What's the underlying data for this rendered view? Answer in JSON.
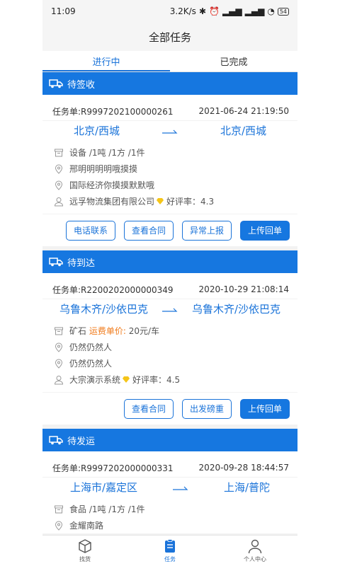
{
  "status_bar": {
    "time": "11:09",
    "speed": "3.2K/s",
    "battery": "54"
  },
  "header": {
    "title": "全部任务"
  },
  "tabs": [
    {
      "label": "进行中"
    },
    {
      "label": "已完成"
    }
  ],
  "cards": [
    {
      "status": "待签收",
      "task_no": "任务单:R9997202100000261",
      "datetime": "2021-06-24 21:19:50",
      "from": "北京/西城",
      "to": "北京/西城",
      "goods": "设备 /1吨 /1方 /1件",
      "addr1": "邢明明明明哦摸摸",
      "addr2": "国际经济你摸摸默默哦",
      "company": "远孚物流集团有限公司",
      "rating": "好评率：4.3",
      "buttons": [
        "电话联系",
        "查看合同",
        "异常上报",
        "上传回单"
      ]
    },
    {
      "status": "待到达",
      "task_no": "任务单:R2200202000000349",
      "datetime": "2020-10-29 21:08:14",
      "from": "乌鲁木齐/沙依巴克",
      "to": "乌鲁木齐/沙依巴克",
      "goods_prefix": "矿石",
      "goods_price_label": "运费单价:",
      "goods_price": "20元/车",
      "addr1": "仍然仍然人",
      "addr2": "仍然仍然人",
      "company": "大宗演示系统",
      "rating": "好评率：4.5",
      "buttons": [
        "查看合同",
        "出发磅重",
        "上传回单"
      ]
    },
    {
      "status": "待发运",
      "task_no": "任务单:R9997202000000331",
      "datetime": "2020-09-28 18:44:57",
      "from": "上海市/嘉定区",
      "to": "上海/普陀",
      "goods": "食品 /1吨 /1方 /1件",
      "addr1": "金耀南路"
    }
  ],
  "bottom_nav": [
    {
      "label": "找货"
    },
    {
      "label": "任务"
    },
    {
      "label": "个人中心"
    }
  ],
  "colors": {
    "primary": "#1677e0",
    "accent_orange": "#f07a1a",
    "gem": "#f5c518"
  }
}
